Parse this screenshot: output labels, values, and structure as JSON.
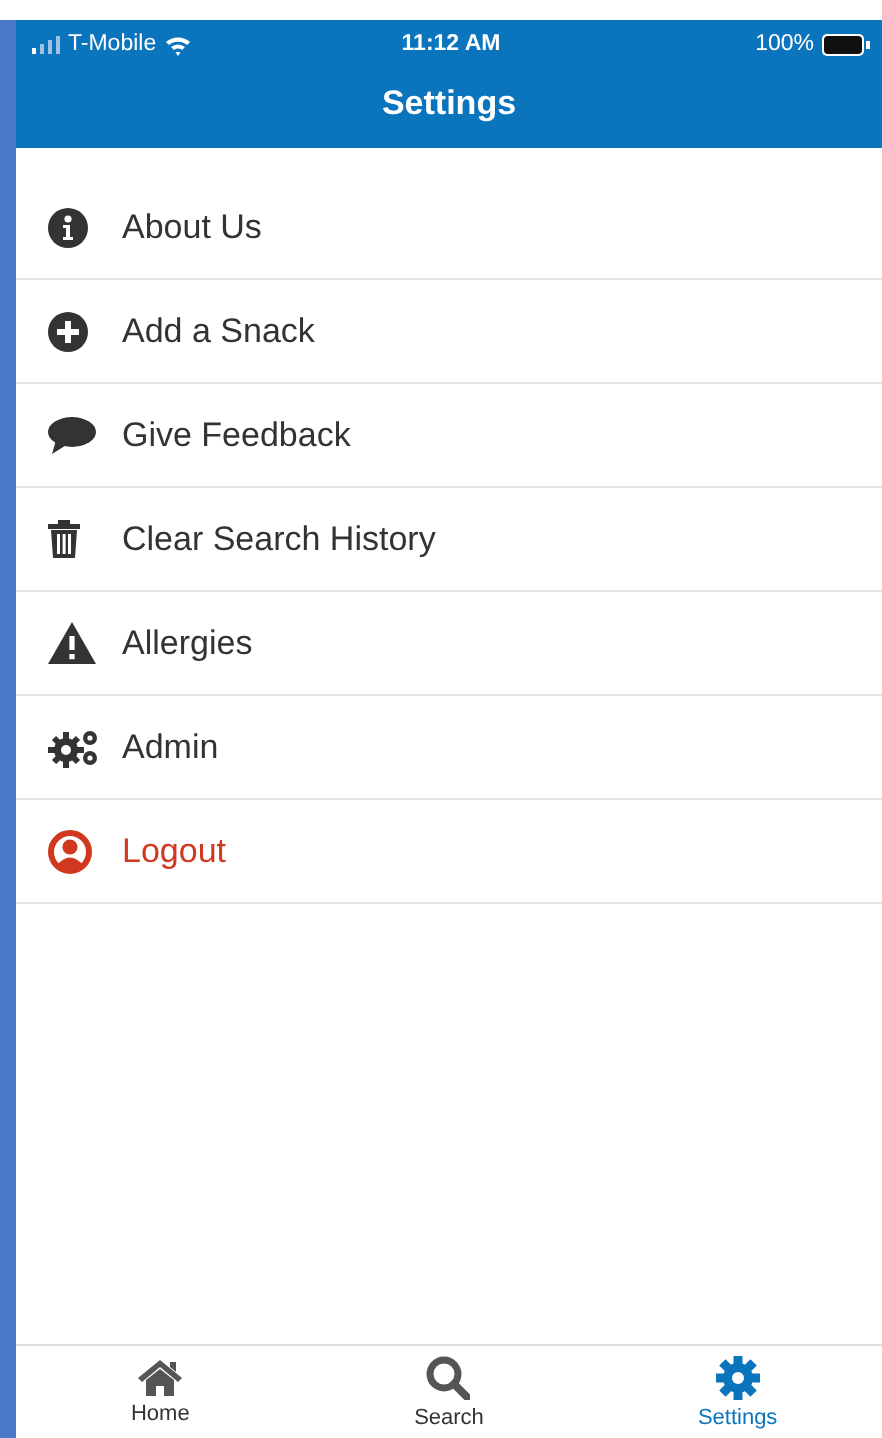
{
  "status_bar": {
    "carrier": "T-Mobile",
    "time": "11:12 AM",
    "battery": "100%"
  },
  "header": {
    "title": "Settings"
  },
  "items": [
    {
      "label": "About Us",
      "kind": "info"
    },
    {
      "label": "Add a Snack",
      "kind": "add"
    },
    {
      "label": "Give Feedback",
      "kind": "comment"
    },
    {
      "label": "Clear Search History",
      "kind": "trash"
    },
    {
      "label": "Allergies",
      "kind": "warning"
    },
    {
      "label": "Admin",
      "kind": "cogs"
    },
    {
      "label": "Logout",
      "kind": "logout"
    }
  ],
  "tabs": [
    {
      "label": "Home",
      "kind": "home",
      "selected": false
    },
    {
      "label": "Search",
      "kind": "search",
      "selected": false
    },
    {
      "label": "Settings",
      "kind": "settings",
      "selected": true
    }
  ]
}
